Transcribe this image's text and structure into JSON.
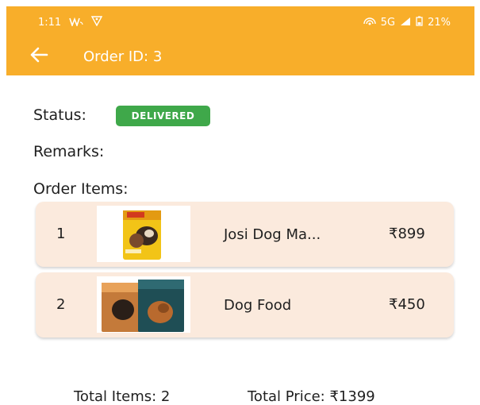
{
  "status_bar": {
    "time": "1:11",
    "network": "5G",
    "battery": "21%"
  },
  "app_bar": {
    "title": "Order ID: 3",
    "back_icon": "arrow-left-icon"
  },
  "order": {
    "status_label": "Status:",
    "status_badge": "DELIVERED",
    "remarks_label": "Remarks:",
    "items_label": "Order Items:",
    "items": [
      {
        "index": "1",
        "name": "Josi Dog Ma...",
        "price": "₹899"
      },
      {
        "index": "2",
        "name": "Dog Food",
        "price": "₹450"
      }
    ]
  },
  "totals": {
    "total_items": "Total Items: 2",
    "total_price": "Total Price: ₹1399"
  },
  "colors": {
    "app_bar": "#f8ae2a",
    "badge": "#3fa84a",
    "card": "#fbeadd"
  }
}
